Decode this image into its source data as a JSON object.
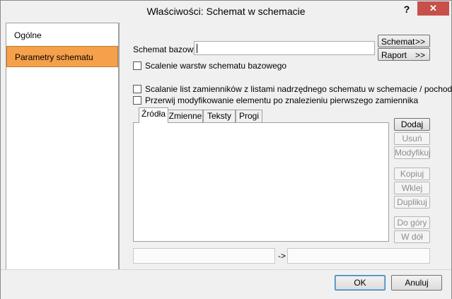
{
  "window": {
    "title": "Właściwości: Schemat w schemacie",
    "help": "?",
    "close": "✕"
  },
  "sidebar": {
    "items": [
      {
        "label": "Ogólne"
      },
      {
        "label": "Parametry schematu"
      }
    ]
  },
  "form": {
    "base_schema_label": "Schemat bazowy",
    "base_schema_value": "",
    "merge_layers_label": "Scalenie warstw schematu bazowego",
    "merge_lists_label": "Scalanie list zamienników z listami nadrzędnego schematu w schemacie / pochodnego",
    "stop_modify_label": "Przerwij modyfikowanie elementu po znalezieniu pierwszego zamiennika",
    "schemat_button": "Schemat",
    "raport_button": "Raport",
    "arrows": ">>",
    "mapping_arrow": "->"
  },
  "tabs": [
    {
      "label": "Źródła"
    },
    {
      "label": "Zmienne"
    },
    {
      "label": "Teksty"
    },
    {
      "label": "Progi"
    }
  ],
  "side_buttons": {
    "dodaj": "Dodaj",
    "usun": "Usuń",
    "modyfikuj": "Modyfikuj",
    "kopiuj": "Kopiuj",
    "wklej": "Wklej",
    "duplikuj": "Duplikuj",
    "do_gory": "Do góry",
    "w_dol": "W dół"
  },
  "footer": {
    "ok": "OK",
    "cancel": "Anuluj"
  }
}
